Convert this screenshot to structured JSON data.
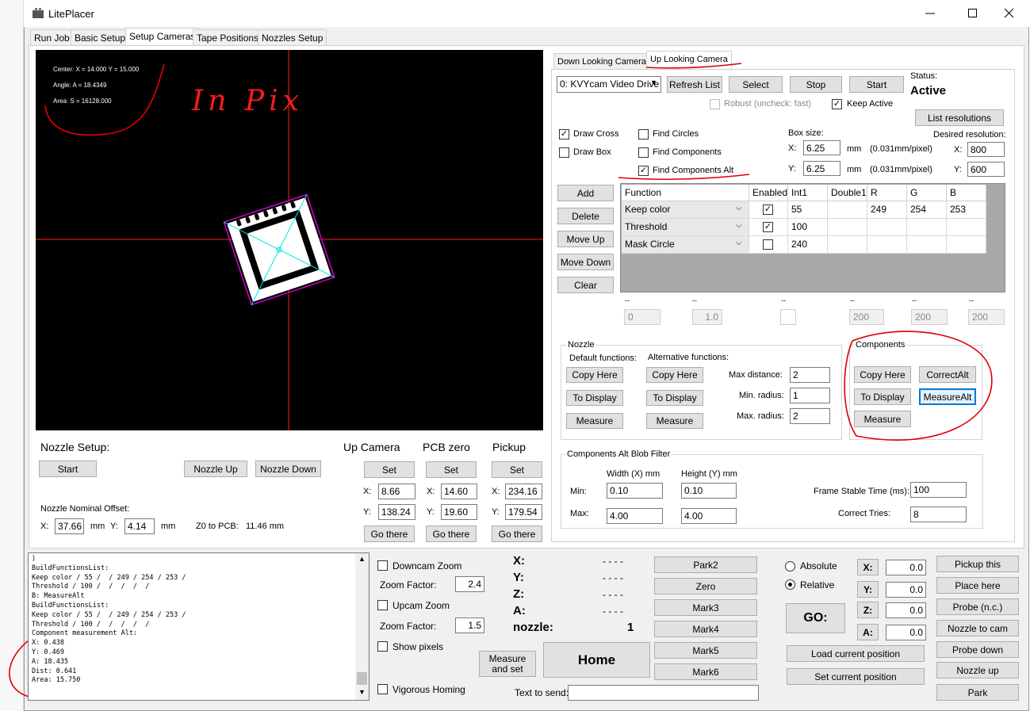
{
  "window": {
    "title": "LitePlacer",
    "min_icon": "minimize-icon",
    "max_icon": "maximize-icon",
    "close_icon": "close-icon"
  },
  "main_tabs": [
    "Run Job",
    "Basic Setup",
    "Setup Cameras",
    "Tape Positions",
    "Nozzles Setup"
  ],
  "video": {
    "center": "Center: X = 14.000 Y = 15.000",
    "angle": "Angle: A =  18.4349",
    "area": "Area: S =  16128.000",
    "handwritten": "In Pix"
  },
  "camera_tabs": [
    "Down Looking Camera",
    "Up Looking Camera"
  ],
  "camera": {
    "device": "0: KVYcam Video Drive",
    "refresh": "Refresh List",
    "select": "Select",
    "stop": "Stop",
    "start": "Start",
    "status_label": "Status:",
    "status_value": "Active",
    "robust": "Robust (uncheck: fast)",
    "keep_active": "Keep Active",
    "list_resolutions": "List resolutions",
    "draw_cross": "Draw Cross",
    "draw_box": "Draw Box",
    "find_circles": "Find Circles",
    "find_components": "Find Components",
    "find_components_alt": "Find Components Alt",
    "box_size_label": "Box size:",
    "box_x": "6.25",
    "box_y": "6.25",
    "mm": "mm",
    "pixel_note": "(0.031mm/pixel)",
    "desired_res_label": "Desired resolution:",
    "res_x": "800",
    "res_y": "600",
    "x_label": "X:",
    "y_label": "Y:"
  },
  "functions": {
    "buttons": [
      "Add",
      "Delete",
      "Move Up",
      "Move Down",
      "Clear"
    ],
    "headers": [
      "Function",
      "Enabled",
      "Int1",
      "Double1",
      "R",
      "G",
      "B"
    ],
    "rows": [
      {
        "function": "Keep color",
        "enabled": true,
        "int1": "55",
        "double1": "",
        "r": "249",
        "g": "254",
        "b": "253"
      },
      {
        "function": "Threshold",
        "enabled": true,
        "int1": "100",
        "double1": "",
        "r": "",
        "g": "",
        "b": ""
      },
      {
        "function": "Mask Circle",
        "enabled": false,
        "int1": "240",
        "double1": "",
        "r": "",
        "g": "",
        "b": ""
      }
    ],
    "spin_dash": "--",
    "spin_values": [
      "0",
      "1.0",
      "",
      "200",
      "200",
      "200"
    ]
  },
  "nozzle_group": {
    "title": "Nozzle",
    "default_label": "Default functions:",
    "alt_label": "Alternative functions:",
    "copy_here": "Copy Here",
    "to_display": "To Display",
    "measure": "Measure",
    "max_distance_label": "Max distance:",
    "max_distance": "2",
    "min_radius_label": "Min. radius:",
    "min_radius": "1",
    "max_radius_label": "Max. radius:",
    "max_radius": "2"
  },
  "components_group": {
    "title": "Components",
    "copy_here": "Copy Here",
    "correct_alt": "CorrectAlt",
    "to_display": "To Display",
    "measure_alt": "MeasureAlt",
    "measure": "Measure"
  },
  "blob_filter": {
    "title": "Components Alt Blob Filter",
    "width_label": "Width (X) mm",
    "height_label": "Height (Y) mm",
    "min_label": "Min:",
    "max_label": "Max:",
    "min_w": "0.10",
    "min_h": "0.10",
    "max_w": "4.00",
    "max_h": "4.00",
    "frame_stable_label": "Frame Stable Time (ms):",
    "frame_stable": "100",
    "correct_tries_label": "Correct Tries:",
    "correct_tries": "8"
  },
  "nozzle_setup": {
    "title": "Nozzle Setup:",
    "start": "Start",
    "nozzle_up": "Nozzle Up",
    "nozzle_down": "Nozzle Down",
    "offset_label": "Nozzle Nominal Offset:",
    "x_label": "X:",
    "x": "37.66",
    "mm": "mm",
    "y_label": "Y:",
    "y": "4.14",
    "z0_label": "Z0 to PCB:",
    "z0": "11.46 mm"
  },
  "positions": {
    "up_camera": {
      "title": "Up Camera",
      "set": "Set",
      "x": "8.66",
      "y": "138.24",
      "go": "Go there"
    },
    "pcb_zero": {
      "title": "PCB zero",
      "set": "Set",
      "x": "14.60",
      "y": "19.60",
      "go": "Go there"
    },
    "pickup": {
      "title": "Pickup",
      "set": "Set",
      "x": "234.16",
      "y": "179.54",
      "go": "Go there"
    },
    "x_label": "X:",
    "y_label": "Y:"
  },
  "log": {
    "lines": [
      ")",
      "BuildFunctionsList:",
      "Keep color / 55 /  / 249 / 254 / 253 /",
      "Threshold / 100 /  /  /  /  /",
      "B: MeasureAlt",
      "BuildFunctionsList:",
      "Keep color / 55 /  / 249 / 254 / 253 /",
      "Threshold / 100 /  /  /  /  /",
      "Component measurement Alt:",
      "X: 0.438",
      "Y: 0.469",
      "A: 18.435",
      "Dist: 0.641",
      "Area: 15.750"
    ]
  },
  "zoom": {
    "downcam": "Downcam Zoom",
    "factor_label": "Zoom Factor:",
    "down_factor": "2.4",
    "upcam": "Upcam Zoom",
    "up_factor": "1.5",
    "show_pixels": "Show pixels",
    "vigorous": "Vigorous Homing"
  },
  "position_readout": {
    "labels": [
      "X:",
      "Y:",
      "Z:",
      "A:"
    ],
    "values": [
      "- - - -",
      "- - - -",
      "- - - -",
      "- - - -"
    ],
    "nozzle_label": "nozzle:",
    "nozzle_value": "1"
  },
  "actions": {
    "measure_set": "Measure and set",
    "home": "Home",
    "marks": [
      "Park2",
      "Zero",
      "Mark3",
      "Mark4",
      "Mark5",
      "Mark6"
    ],
    "text_to_send": "Text to send:"
  },
  "move": {
    "absolute": "Absolute",
    "relative": "Relative",
    "go": "GO:",
    "load": "Load current position",
    "set_current": "Set current position",
    "axes": [
      "X:",
      "Y:",
      "Z:",
      "A:"
    ],
    "axis_values": [
      "0.0",
      "0.0",
      "0.0",
      "0.0"
    ]
  },
  "right_buttons": [
    "Pickup this",
    "Place here",
    "Probe (n.c.)",
    "Nozzle to cam",
    "Probe down",
    "Nozzle up",
    "Park"
  ]
}
